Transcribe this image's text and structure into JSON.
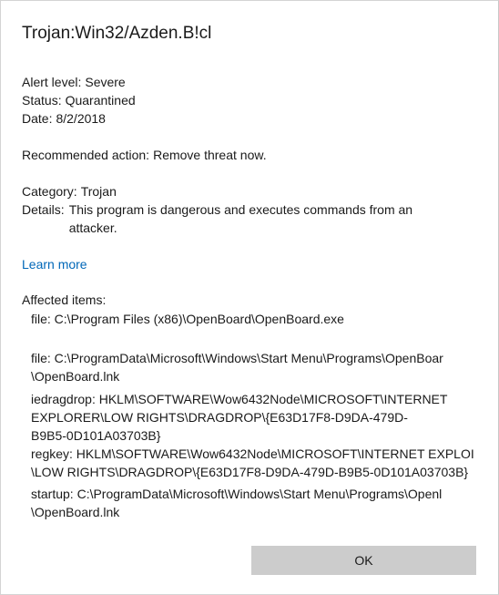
{
  "threat": {
    "name": "Trojan:Win32/Azden.B!cl"
  },
  "alert": {
    "level_label": "Alert level:",
    "level_value": "Severe",
    "status_label": "Status:",
    "status_value": "Quarantined",
    "date_label": "Date:",
    "date_value": "8/2/2018"
  },
  "recommendation": {
    "label": "Recommended action:",
    "value": "Remove threat now."
  },
  "info": {
    "category_label": "Category:",
    "category_value": "Trojan",
    "details_label": "Details:",
    "details_value": "This program is dangerous and executes commands from an attacker."
  },
  "learn_more": "Learn more",
  "affected": {
    "header": "Affected items:",
    "items": [
      {
        "lines": [
          "file: C:\\Program Files (x86)\\OpenBoard\\OpenBoard.exe"
        ]
      },
      {
        "lines": [
          "file: C:\\ProgramData\\Microsoft\\Windows\\Start Menu\\Programs\\OpenBoar",
          "\\OpenBoard.lnk"
        ]
      },
      {
        "lines": [
          "iedragdrop: HKLM\\SOFTWARE\\Wow6432Node\\MICROSOFT\\INTERNET",
          "EXPLORER\\LOW RIGHTS\\DRAGDROP\\{E63D17F8-D9DA-479D-",
          "B9B5-0D101A03703B}"
        ]
      },
      {
        "lines": [
          "regkey: HKLM\\SOFTWARE\\Wow6432Node\\MICROSOFT\\INTERNET EXPLOI",
          "\\LOW RIGHTS\\DRAGDROP\\{E63D17F8-D9DA-479D-B9B5-0D101A03703B}"
        ]
      },
      {
        "lines": [
          "startup: C:\\ProgramData\\Microsoft\\Windows\\Start Menu\\Programs\\Openl",
          "\\OpenBoard.lnk"
        ]
      }
    ]
  },
  "buttons": {
    "ok": "OK"
  },
  "colors": {
    "link": "#0067b8",
    "button_bg": "#cccccc"
  }
}
